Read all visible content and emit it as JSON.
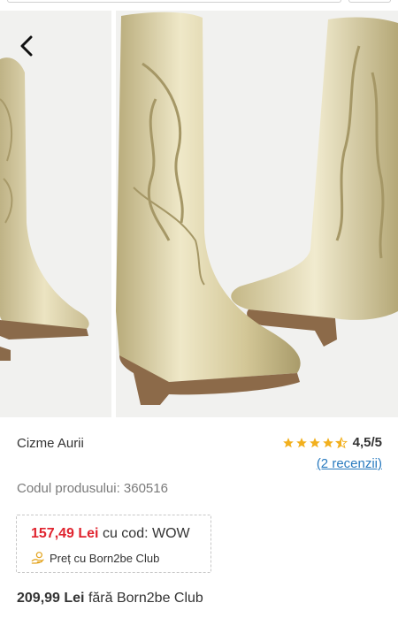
{
  "nav": {
    "back_icon": "chevron-left-icon"
  },
  "product": {
    "title": "Cizme Aurii",
    "rating_value": "4,5/5",
    "rating_stars": 4.5,
    "reviews_label": "(2 recenzii)",
    "code_label": "Codul produsului: 360516"
  },
  "promo": {
    "price": "157,49 Lei",
    "code_text": "cu cod: WOW",
    "club_icon": "hand-coin-icon",
    "club_label": "Preț cu Born2be Club"
  },
  "regular": {
    "price": "209,99 Lei",
    "suffix": "fără Born2be Club"
  },
  "colors": {
    "accent_red": "#e0242f",
    "link_blue": "#2a7bbf",
    "star_gold": "#f2b01e",
    "boot_gold": "#d8cfa6"
  }
}
